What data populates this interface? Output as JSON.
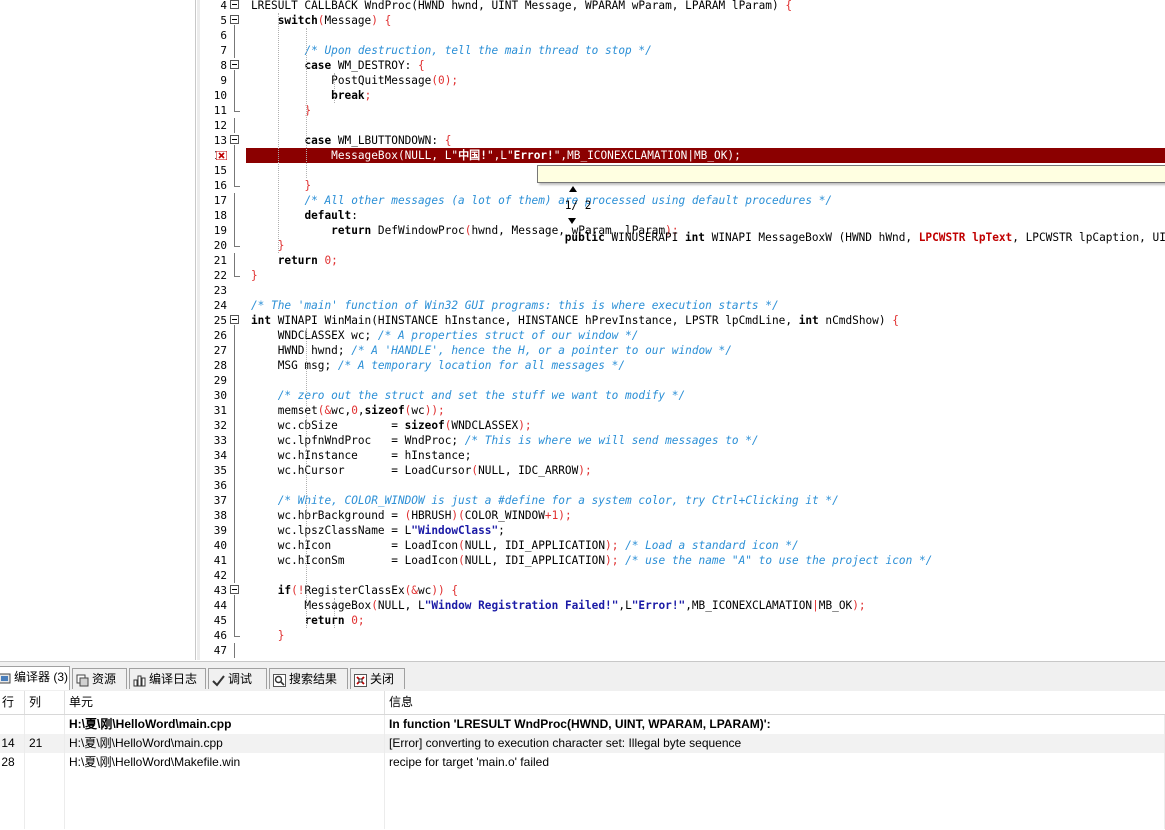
{
  "editor": {
    "lines": [
      {
        "n": "4",
        "fold": "box",
        "segs": [
          [
            "",
            "LRESULT CALLBACK WndProc(HWND hwnd, UINT Message, WPARAM wParam, LPARAM lParam) "
          ],
          [
            "sym",
            "{"
          ]
        ]
      },
      {
        "n": "5",
        "fold": "box",
        "segs": [
          [
            "",
            "    "
          ],
          [
            "kw",
            "switch"
          ],
          [
            "sym",
            "("
          ],
          [
            "",
            "Message"
          ],
          [
            "sym",
            ")"
          ],
          [
            "",
            " "
          ],
          [
            "sym",
            "{"
          ]
        ]
      },
      {
        "n": "6",
        "fold": "line",
        "segs": []
      },
      {
        "n": "7",
        "fold": "line",
        "segs": [
          [
            "",
            "        "
          ],
          [
            "cm",
            "/* Upon destruction, tell the main thread to stop */"
          ]
        ]
      },
      {
        "n": "8",
        "fold": "box",
        "segs": [
          [
            "",
            "        "
          ],
          [
            "kw",
            "case"
          ],
          [
            "",
            " WM_DESTROY: "
          ],
          [
            "sym",
            "{"
          ]
        ]
      },
      {
        "n": "9",
        "fold": "line",
        "segs": [
          [
            "",
            "            PostQuitMessage"
          ],
          [
            "sym",
            "("
          ],
          [
            "num",
            "0"
          ],
          [
            "sym",
            ");"
          ]
        ]
      },
      {
        "n": "10",
        "fold": "line",
        "segs": [
          [
            "",
            "            "
          ],
          [
            "kw",
            "break"
          ],
          [
            "sym",
            ";"
          ]
        ]
      },
      {
        "n": "11",
        "fold": "end",
        "segs": [
          [
            "",
            "        "
          ],
          [
            "sym",
            "}"
          ]
        ]
      },
      {
        "n": "12",
        "fold": "line",
        "segs": []
      },
      {
        "n": "13",
        "fold": "box",
        "segs": [
          [
            "",
            "        "
          ],
          [
            "kw",
            "case"
          ],
          [
            "",
            " WM_LBUTTONDOWN: "
          ],
          [
            "sym",
            "{"
          ]
        ]
      },
      {
        "n": "14",
        "fold": "line",
        "bp": true,
        "hl": true,
        "segs": [
          [
            "",
            "            MessageBox(NULL, L\""
          ],
          [
            "kw",
            "中国!"
          ],
          [
            "",
            "\",L\""
          ],
          [
            "kw",
            "Error!"
          ],
          [
            "",
            "\",MB_ICONEXCLAMATION|MB_OK);"
          ]
        ]
      },
      {
        "n": "15",
        "fold": "line",
        "segs": []
      },
      {
        "n": "16",
        "fold": "end",
        "segs": [
          [
            "",
            "        "
          ],
          [
            "sym",
            "}"
          ]
        ]
      },
      {
        "n": "17",
        "fold": "line",
        "segs": [
          [
            "",
            "        "
          ],
          [
            "cm",
            "/* All other messages (a lot of them) are processed using default procedures */"
          ]
        ]
      },
      {
        "n": "18",
        "fold": "line",
        "segs": [
          [
            "",
            "        "
          ],
          [
            "kw",
            "default"
          ],
          [
            "",
            ":"
          ]
        ]
      },
      {
        "n": "19",
        "fold": "line",
        "segs": [
          [
            "",
            "            "
          ],
          [
            "kw",
            "return"
          ],
          [
            "",
            " DefWindowProc"
          ],
          [
            "sym",
            "("
          ],
          [
            "",
            "hwnd, Message, wParam, lParam"
          ],
          [
            "sym",
            ");"
          ]
        ]
      },
      {
        "n": "20",
        "fold": "end",
        "segs": [
          [
            "",
            "    "
          ],
          [
            "sym",
            "}"
          ]
        ]
      },
      {
        "n": "21",
        "fold": "line",
        "segs": [
          [
            "",
            "    "
          ],
          [
            "kw",
            "return"
          ],
          [
            "",
            " "
          ],
          [
            "num",
            "0"
          ],
          [
            "sym",
            ";"
          ]
        ]
      },
      {
        "n": "22",
        "fold": "end",
        "segs": [
          [
            "sym",
            "}"
          ]
        ]
      },
      {
        "n": "23",
        "fold": "",
        "segs": []
      },
      {
        "n": "24",
        "fold": "",
        "segs": [
          [
            "cm",
            "/* The 'main' function of Win32 GUI programs: this is where execution starts */"
          ]
        ]
      },
      {
        "n": "25",
        "fold": "box",
        "segs": [
          [
            "kw",
            "int"
          ],
          [
            "",
            " WINAPI WinMain(HINSTANCE hInstance, HINSTANCE hPrevInstance, LPSTR lpCmdLine, "
          ],
          [
            "kw",
            "int"
          ],
          [
            "",
            " nCmdShow) "
          ],
          [
            "sym",
            "{"
          ]
        ]
      },
      {
        "n": "26",
        "fold": "line",
        "segs": [
          [
            "",
            "    WNDCLASSEX wc; "
          ],
          [
            "cm",
            "/* A properties struct of our window */"
          ]
        ]
      },
      {
        "n": "27",
        "fold": "line",
        "segs": [
          [
            "",
            "    HWND hwnd; "
          ],
          [
            "cm",
            "/* A 'HANDLE', hence the H, or a pointer to our window */"
          ]
        ]
      },
      {
        "n": "28",
        "fold": "line",
        "segs": [
          [
            "",
            "    MSG msg; "
          ],
          [
            "cm",
            "/* A temporary location for all messages */"
          ]
        ]
      },
      {
        "n": "29",
        "fold": "line",
        "segs": []
      },
      {
        "n": "30",
        "fold": "line",
        "segs": [
          [
            "",
            "    "
          ],
          [
            "cm",
            "/* zero out the struct and set the stuff we want to modify */"
          ]
        ]
      },
      {
        "n": "31",
        "fold": "line",
        "segs": [
          [
            "",
            "    memset"
          ],
          [
            "sym",
            "(&"
          ],
          [
            "",
            "wc,"
          ],
          [
            "num",
            "0"
          ],
          [
            "",
            ","
          ],
          [
            "kw",
            "sizeof"
          ],
          [
            "sym",
            "("
          ],
          [
            "",
            "wc"
          ],
          [
            "sym",
            "));"
          ]
        ]
      },
      {
        "n": "32",
        "fold": "line",
        "segs": [
          [
            "",
            "    wc.cbSize        = "
          ],
          [
            "kw",
            "sizeof"
          ],
          [
            "sym",
            "("
          ],
          [
            "",
            "WNDCLASSEX"
          ],
          [
            "sym",
            ");"
          ]
        ]
      },
      {
        "n": "33",
        "fold": "line",
        "segs": [
          [
            "",
            "    wc.lpfnWndProc   = WndProc; "
          ],
          [
            "cm",
            "/* This is where we will send messages to */"
          ]
        ]
      },
      {
        "n": "34",
        "fold": "line",
        "segs": [
          [
            "",
            "    wc.hInstance     = hInstance;"
          ]
        ]
      },
      {
        "n": "35",
        "fold": "line",
        "segs": [
          [
            "",
            "    wc.hCursor       = LoadCursor"
          ],
          [
            "sym",
            "("
          ],
          [
            "",
            "NULL, IDC_ARROW"
          ],
          [
            "sym",
            ");"
          ]
        ]
      },
      {
        "n": "36",
        "fold": "line",
        "segs": []
      },
      {
        "n": "37",
        "fold": "line",
        "segs": [
          [
            "",
            "    "
          ],
          [
            "cm",
            "/* White, COLOR_WINDOW is just a #define for a system color, try Ctrl+Clicking it */"
          ]
        ]
      },
      {
        "n": "38",
        "fold": "line",
        "segs": [
          [
            "",
            "    wc.hbrBackground = "
          ],
          [
            "sym",
            "("
          ],
          [
            "",
            "HBRUSH"
          ],
          [
            "sym",
            ")("
          ],
          [
            "",
            "COLOR_WINDOW"
          ],
          [
            "sym",
            "+"
          ],
          [
            "num",
            "1"
          ],
          [
            "sym",
            ");"
          ]
        ]
      },
      {
        "n": "39",
        "fold": "line",
        "segs": [
          [
            "",
            "    wc.lpszClassName = L"
          ],
          [
            "str",
            "\"WindowClass\""
          ],
          [
            "",
            ";"
          ]
        ]
      },
      {
        "n": "40",
        "fold": "line",
        "segs": [
          [
            "",
            "    wc.hIcon         = LoadIcon"
          ],
          [
            "sym",
            "("
          ],
          [
            "",
            "NULL, IDI_APPLICATION"
          ],
          [
            "sym",
            ");"
          ],
          [
            "",
            " "
          ],
          [
            "cm",
            "/* Load a standard icon */"
          ]
        ]
      },
      {
        "n": "41",
        "fold": "line",
        "segs": [
          [
            "",
            "    wc.hIconSm       = LoadIcon"
          ],
          [
            "sym",
            "("
          ],
          [
            "",
            "NULL, IDI_APPLICATION"
          ],
          [
            "sym",
            ");"
          ],
          [
            "",
            " "
          ],
          [
            "cm",
            "/* use the name \"A\" to use the project icon */"
          ]
        ]
      },
      {
        "n": "42",
        "fold": "line",
        "segs": []
      },
      {
        "n": "43",
        "fold": "box",
        "segs": [
          [
            "",
            "    "
          ],
          [
            "kw",
            "if"
          ],
          [
            "sym",
            "(!"
          ],
          [
            "",
            "RegisterClassEx"
          ],
          [
            "sym",
            "(&"
          ],
          [
            "",
            "wc"
          ],
          [
            "sym",
            "))"
          ],
          [
            "",
            " "
          ],
          [
            "sym",
            "{"
          ]
        ]
      },
      {
        "n": "44",
        "fold": "line",
        "segs": [
          [
            "",
            "        MessageBox"
          ],
          [
            "sym",
            "("
          ],
          [
            "",
            "NULL, L"
          ],
          [
            "str",
            "\"Window Registration Failed!\""
          ],
          [
            "",
            ",L"
          ],
          [
            "str",
            "\"Error!\""
          ],
          [
            "",
            ",MB_ICONEXCLAMATION"
          ],
          [
            "sym",
            "|"
          ],
          [
            "",
            "MB_OK"
          ],
          [
            "sym",
            ");"
          ]
        ]
      },
      {
        "n": "45",
        "fold": "line",
        "segs": [
          [
            "",
            "        "
          ],
          [
            "kw",
            "return"
          ],
          [
            "",
            " "
          ],
          [
            "num",
            "0"
          ],
          [
            "sym",
            ";"
          ]
        ]
      },
      {
        "n": "46",
        "fold": "end",
        "segs": [
          [
            "",
            "    "
          ],
          [
            "sym",
            "}"
          ]
        ]
      },
      {
        "n": "47",
        "fold": "line",
        "segs": []
      }
    ],
    "tooltip": {
      "counter": "1/ 2",
      "prefix": "public WINUSERAPI int WINAPI MessageBoxW (HWND hWnd, ",
      "param": "LPCWSTR lpText",
      "suffix": ", LPCWSTR lpCaption, UINT uType)"
    }
  },
  "tabs": [
    {
      "label": "编译器 (3)",
      "icon": "compiler-icon",
      "active": true
    },
    {
      "label": "资源",
      "icon": "resource-icon"
    },
    {
      "label": "编译日志",
      "icon": "log-chart-icon"
    },
    {
      "label": "调试",
      "icon": "debug-check-icon"
    },
    {
      "label": "搜索结果",
      "icon": "search-results-icon"
    },
    {
      "label": "关闭",
      "icon": "close-icon"
    }
  ],
  "messages": {
    "headers": {
      "line": "行",
      "col": "列",
      "unit": "单元",
      "info": "信息"
    },
    "rows": [
      {
        "line": "",
        "col": "",
        "unit": "H:\\夏\\刚\\HelloWord\\main.cpp",
        "info": "In function 'LRESULT WndProc(HWND, UINT, WPARAM, LPARAM)':"
      },
      {
        "line": "14",
        "col": "21",
        "unit": "H:\\夏\\刚\\HelloWord\\main.cpp",
        "info": "[Error] converting to execution character set: Illegal byte sequence"
      },
      {
        "line": "28",
        "col": "",
        "unit": "H:\\夏\\刚\\HelloWord\\Makefile.win",
        "info": "recipe for target 'main.o' failed"
      }
    ]
  },
  "colors": {
    "error_line": "#8b0000",
    "comment": "#2b8fd6",
    "number": "#e03030",
    "string": "#1a1aa6"
  }
}
